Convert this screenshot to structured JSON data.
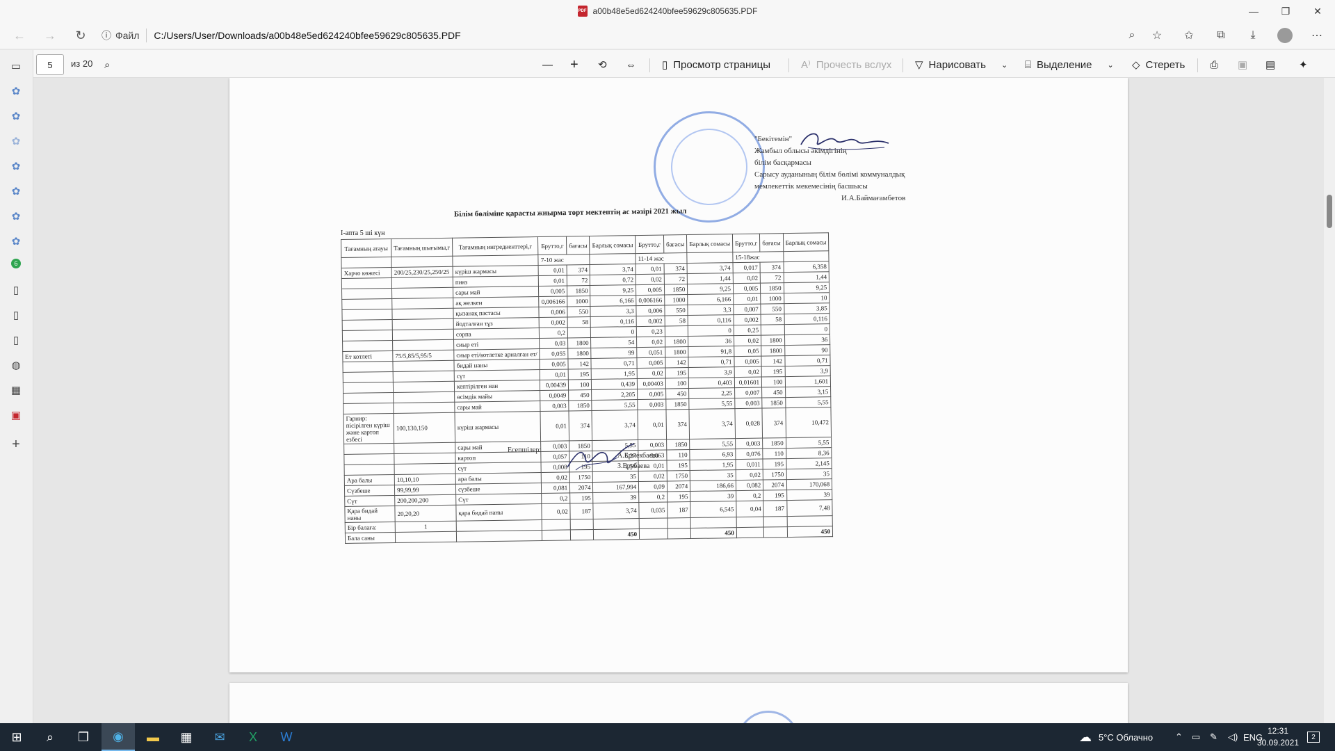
{
  "window": {
    "tab_title": "a00b48e5ed624240bfee59629c805635.PDF",
    "minimize": "—",
    "maximize": "❐",
    "close": "✕"
  },
  "address": {
    "info_label": "Файл",
    "url": "C:/Users/User/Downloads/a00b48e5ed624240bfee59629c805635.PDF"
  },
  "pdf_toolbar": {
    "page_current": "5",
    "page_total": "из 20",
    "page_view_label": "Просмотр страницы",
    "read_aloud_label": "Прочесть вслух",
    "draw_label": "Нарисовать",
    "highlight_label": "Выделение",
    "erase_label": "Стереть"
  },
  "document": {
    "approval_lines": [
      "\"Бекітемін\"",
      "Жамбыл облысы әкімдігінің",
      "білім басқармасы",
      "Сарысу ауданының білім бөлімі коммуналдық",
      "мемлекеттік мекемесінің басшысы",
      "И.А.Баймағамбетов"
    ],
    "title": "Білім бөліміне қарасты жиырма төрт мектептің ас мәзірі  2021 жыл",
    "week_note": "I-апта 5 ші күн",
    "headers": [
      "Тағамның атауы",
      "Тағамның шығымы,г",
      "Тағамның ингредиенттері,г",
      "Брутто,г",
      "бағасы",
      "Барлық сомасы",
      "Брутто,г",
      "бағасы",
      "Барлық сомасы",
      "Брутто,г",
      "бағасы",
      "Барлық сомасы"
    ],
    "age_groups": [
      "7-10 жас",
      "11-14 жас",
      "15-18жас"
    ],
    "rows": [
      [
        "Харчо көжесі",
        "200/25,230/25,250/25",
        "күріш жармасы",
        "0,01",
        "374",
        "3,74",
        "0,01",
        "374",
        "3,74",
        "0,017",
        "374",
        "6,358"
      ],
      [
        "",
        "",
        "пияз",
        "0,01",
        "72",
        "0,72",
        "0,02",
        "72",
        "1,44",
        "0,02",
        "72",
        "1,44"
      ],
      [
        "",
        "",
        "сары май",
        "0,005",
        "1850",
        "9,25",
        "0,005",
        "1850",
        "9,25",
        "0,005",
        "1850",
        "9,25"
      ],
      [
        "",
        "",
        "ақ желкен",
        "0,006166",
        "1000",
        "6,166",
        "0,006166",
        "1000",
        "6,166",
        "0,01",
        "1000",
        "10"
      ],
      [
        "",
        "",
        "қызанақ пастасы",
        "0,006",
        "550",
        "3,3",
        "0,006",
        "550",
        "3,3",
        "0,007",
        "550",
        "3,85"
      ],
      [
        "",
        "",
        "йодталған тұз",
        "0,002",
        "58",
        "0,116",
        "0,002",
        "58",
        "0,116",
        "0,002",
        "58",
        "0,116"
      ],
      [
        "",
        "",
        "сорпа",
        "0,2",
        "",
        "0",
        "0,23",
        "",
        "0",
        "0,25",
        "",
        "0"
      ],
      [
        "",
        "",
        "сиыр еті",
        "0,03",
        "1800",
        "54",
        "0,02",
        "1800",
        "36",
        "0,02",
        "1800",
        "36"
      ],
      [
        "Ет котлеті",
        "75/5,85/5,95/5",
        "сиыр еті/котлетке арналған ет/",
        "0,055",
        "1800",
        "99",
        "0,051",
        "1800",
        "91,8",
        "0,05",
        "1800",
        "90"
      ],
      [
        "",
        "",
        "бидай наны",
        "0,005",
        "142",
        "0,71",
        "0,005",
        "142",
        "0,71",
        "0,005",
        "142",
        "0,71"
      ],
      [
        "",
        "",
        "сүт",
        "0,01",
        "195",
        "1,95",
        "0,02",
        "195",
        "3,9",
        "0,02",
        "195",
        "3,9"
      ],
      [
        "",
        "",
        "кептірілген нан",
        "0,00439",
        "100",
        "0,439",
        "0,00403",
        "100",
        "0,403",
        "0,01601",
        "100",
        "1,601"
      ],
      [
        "",
        "",
        "өсімдік майы",
        "0,0049",
        "450",
        "2,205",
        "0,005",
        "450",
        "2,25",
        "0,007",
        "450",
        "3,15"
      ],
      [
        "",
        "",
        "сары май",
        "0,003",
        "1850",
        "5,55",
        "0,003",
        "1850",
        "5,55",
        "0,003",
        "1850",
        "5,55"
      ],
      [
        "Гарнир: пісірілген күріш және картоп езбесі",
        "100,130,150",
        "күріш жармасы",
        "0,01",
        "374",
        "3,74",
        "0,01",
        "374",
        "3,74",
        "0,028",
        "374",
        "10,472"
      ],
      [
        "",
        "",
        "сары май",
        "0,003",
        "1850",
        "5,55",
        "0,003",
        "1850",
        "5,55",
        "0,003",
        "1850",
        "5,55"
      ],
      [
        "",
        "",
        "картоп",
        "0,057",
        "110",
        "6,27",
        "0,063",
        "110",
        "6,93",
        "0,076",
        "110",
        "8,36"
      ],
      [
        "",
        "",
        "сүт",
        "0,008",
        "195",
        "1,56",
        "0,01",
        "195",
        "1,95",
        "0,011",
        "195",
        "2,145"
      ],
      [
        "Ара балы",
        "10,10,10",
        "ара балы",
        "0,02",
        "1750",
        "35",
        "0,02",
        "1750",
        "35",
        "0,02",
        "1750",
        "35"
      ],
      [
        "Сүзбеше",
        "99,99,99",
        "сүзбеше",
        "0,081",
        "2074",
        "167,994",
        "0,09",
        "2074",
        "186,66",
        "0,082",
        "2074",
        "170,068"
      ],
      [
        "Сүт",
        "200,200,200",
        "Сүт",
        "0,2",
        "195",
        "39",
        "0,2",
        "195",
        "39",
        "0,2",
        "195",
        "39"
      ],
      [
        "Қара бидай наны",
        "20,20,20",
        "қара бидай наны",
        "0,02",
        "187",
        "3,74",
        "0,035",
        "187",
        "6,545",
        "0,04",
        "187",
        "7,48"
      ]
    ],
    "per_child_label": "Бір балаға:",
    "per_child_value": "1",
    "child_count_label": "Бала саны",
    "totals": [
      "450",
      "450",
      "450"
    ],
    "signers_label": "Есепшілер:",
    "signer_names": [
      "А.Ермекбаева",
      "З.Ерубаева"
    ]
  },
  "taskbar": {
    "weather": "5°C  Облачно",
    "lang": "ENG",
    "time": "12:31",
    "date": "30.09.2021",
    "notifications": "2"
  }
}
